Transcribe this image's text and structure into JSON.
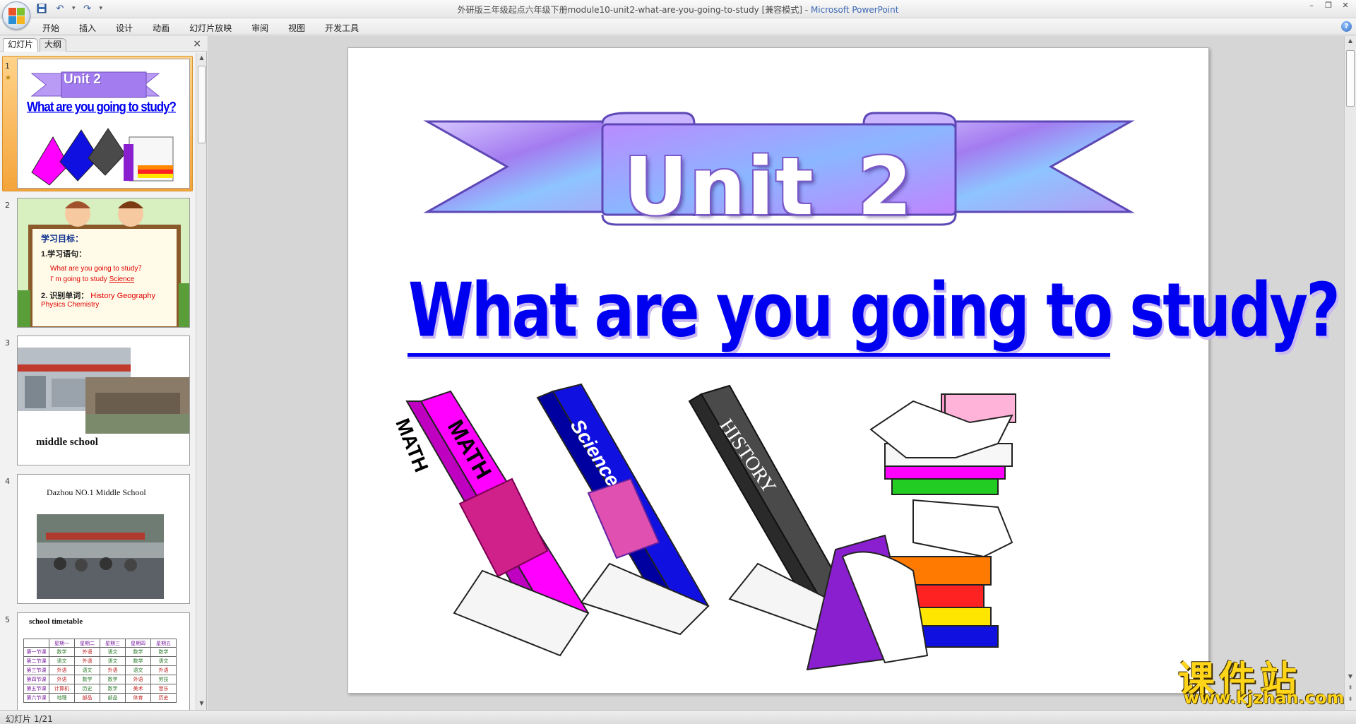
{
  "window": {
    "title": "外研版三年级起点六年级下册module10-unit2-what-are-you-going-to-study [兼容模式] - ",
    "app_name": "Microsoft PowerPoint"
  },
  "quick_access": {
    "save_icon": "save-icon",
    "undo_icon": "undo-icon",
    "redo_icon": "redo-icon"
  },
  "menu": {
    "tabs": [
      "开始",
      "插入",
      "设计",
      "动画",
      "幻灯片放映",
      "审阅",
      "视图",
      "开发工具"
    ]
  },
  "left_panel": {
    "tab_slides": "幻灯片",
    "tab_outline": "大纲",
    "close": "×"
  },
  "thumbnails": [
    {
      "num": "1",
      "unit": "Unit 2",
      "title": "What are you going to study?"
    },
    {
      "num": "2",
      "goal": "学习目标：",
      "line1": "1.学习语句：",
      "line2": "What are you going to study？",
      "line3": "I’ m going to study",
      "line3_em": "Science",
      "line4": "2. 识别单词：",
      "line4_words": "History  Geography",
      "line5": "Physics    Chemistry"
    },
    {
      "num": "3",
      "caption": "middle   school"
    },
    {
      "num": "4",
      "caption": "Dazhou NO.1  Middle School"
    },
    {
      "num": "5",
      "caption": "school  timetable",
      "table_header": [
        "",
        "星期一",
        "星期二",
        "星期三",
        "星期四",
        "星期五"
      ],
      "table_rows": [
        [
          "第一节课",
          "数学",
          "外语",
          "语文",
          "数学",
          "数学"
        ],
        [
          "第二节课",
          "语文",
          "外语",
          "语文",
          "数学",
          "语文"
        ],
        [
          "第三节课",
          "外语",
          "语文",
          "外语",
          "语文",
          "外语"
        ],
        [
          "第四节课",
          "外语",
          "数学",
          "数学",
          "外语",
          "劳技"
        ],
        [
          "第五节课",
          "计算机",
          "历史",
          "数学",
          "美术",
          "音乐"
        ],
        [
          "第六节课",
          "地理",
          "部品",
          "部品",
          "体育",
          "历史"
        ]
      ]
    }
  ],
  "slide": {
    "unit_word": "Unit",
    "unit_number": "2",
    "headline": "What are you going to study?",
    "book1": "MATH",
    "book2": "Science",
    "book3": "HISTORY"
  },
  "status": {
    "slide_counter": "幻灯片 1/21"
  },
  "watermark": {
    "cn": "课件站",
    "url": "www.kjzhan.com"
  },
  "colors": {
    "headline_blue": "#0000f0",
    "banner_purple": "#a37cf0",
    "book_magenta": "#ff00ff",
    "book_blue": "#1010e0",
    "book_gray": "#4a4a4a",
    "selection_orange": "#f4a43a"
  }
}
